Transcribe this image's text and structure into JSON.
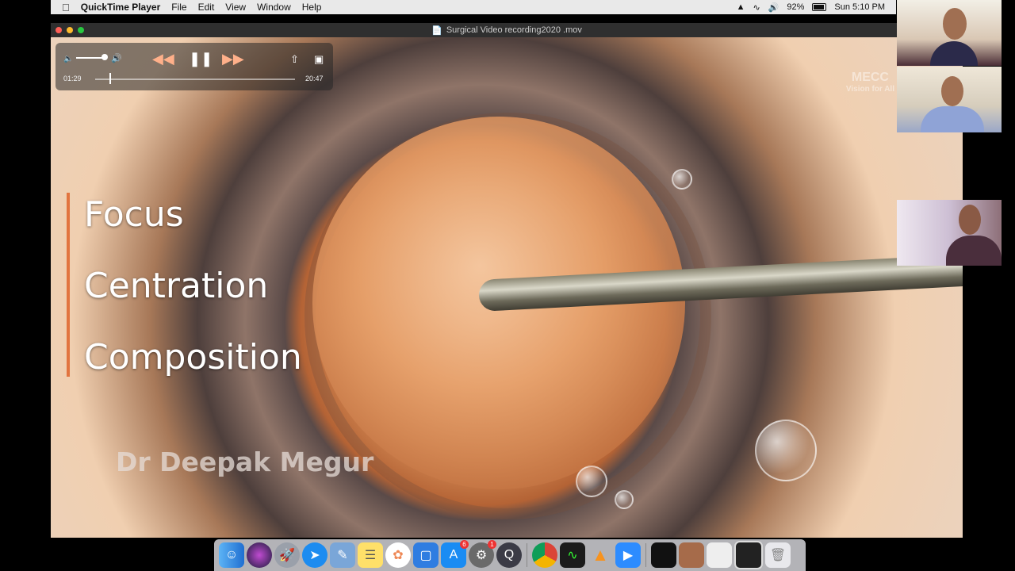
{
  "menubar": {
    "app_name": "QuickTime Player",
    "menus": [
      "File",
      "Edit",
      "View",
      "Window",
      "Help"
    ],
    "battery": "92%",
    "clock": "Sun 5:10 PM"
  },
  "window": {
    "title": "Surgical Video recording2020 .mov"
  },
  "player": {
    "elapsed": "01:29",
    "duration": "20:47",
    "progress": 0.071
  },
  "video": {
    "overlay_words": [
      "Focus",
      "Centration",
      "Composition"
    ],
    "credit": "Dr Deepak Megur",
    "watermark_main": "MECC",
    "watermark_sub": "Vision for All"
  },
  "dock": {
    "apps": [
      "finder-icon",
      "siri-icon",
      "launchpad-icon",
      "safari-icon",
      "preview-icon",
      "notes-icon",
      "photos-icon",
      "keynote-icon",
      "app-store-icon",
      "system-preferences-icon",
      "quicktime-icon",
      "chrome-icon",
      "activity-monitor-icon",
      "vlc-icon",
      "zoom-icon",
      "minimized-window-1",
      "minimized-window-2",
      "minimized-window-3",
      "minimized-window-4",
      "trash-icon"
    ],
    "app_store_badge": "6",
    "system_prefs_badge": "1"
  },
  "colors": {
    "accent_bar": "#e2743f",
    "menubar_bg": "#e9e9e9",
    "titlebar_bg": "#2f2f2f"
  }
}
